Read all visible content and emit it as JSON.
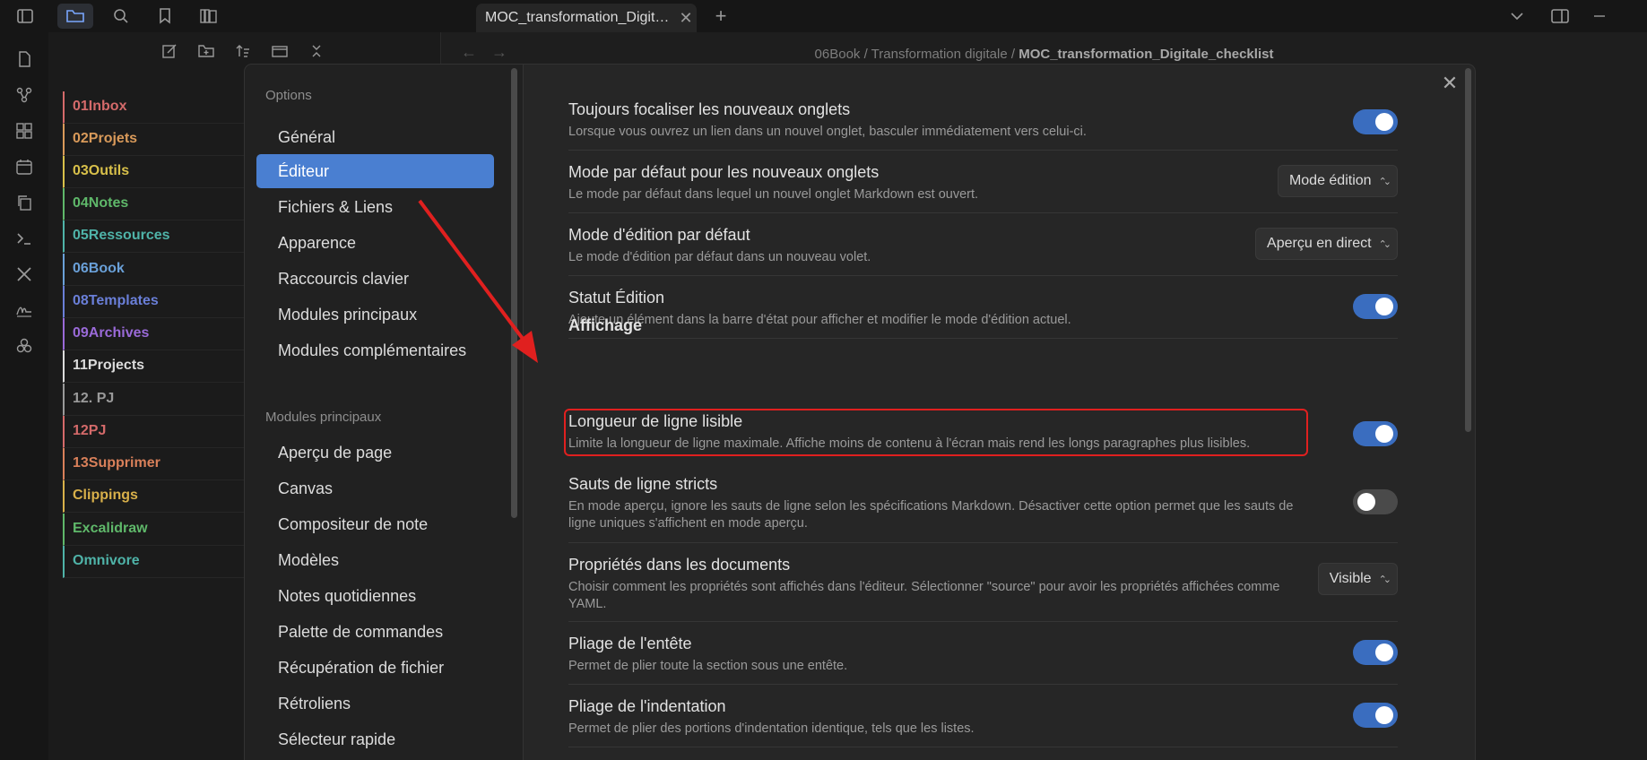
{
  "tab": {
    "title": "MOC_transformation_Digit…",
    "close": "✕",
    "new_tab": "+"
  },
  "breadcrumb": {
    "part1": "06Book",
    "sep": "/",
    "part2": "Transformation digitale",
    "current": "MOC_transformation_Digitale_checklist"
  },
  "folders": [
    {
      "label": "01Inbox",
      "color": "#d46a6a"
    },
    {
      "label": "02Projets",
      "color": "#d99a5a"
    },
    {
      "label": "03Outils",
      "color": "#d8c04a"
    },
    {
      "label": "04Notes",
      "color": "#5fb86a"
    },
    {
      "label": "05Ressources",
      "color": "#4fb3a8"
    },
    {
      "label": "06Book",
      "color": "#6aa0d8"
    },
    {
      "label": "08Templates",
      "color": "#6a7fd8"
    },
    {
      "label": "09Archives",
      "color": "#9a6ad8"
    },
    {
      "label": "11Projects",
      "color": "#dcdcdc"
    },
    {
      "label": "12. PJ",
      "color": "#9a9a9a"
    },
    {
      "label": "12PJ",
      "color": "#d46a6a"
    },
    {
      "label": "13Supprimer",
      "color": "#d9805a"
    },
    {
      "label": "Clippings",
      "color": "#d8b04a"
    },
    {
      "label": "Excalidraw",
      "color": "#5fb86a"
    },
    {
      "label": "Omnivore",
      "color": "#4fb3a8"
    }
  ],
  "settings_sidebar": {
    "heading_options": "Options",
    "options": [
      "Général",
      "Éditeur",
      "Fichiers & Liens",
      "Apparence",
      "Raccourcis clavier",
      "Modules principaux",
      "Modules complémentaires"
    ],
    "active_option": "Éditeur",
    "heading_core": "Modules principaux",
    "core": [
      "Aperçu de page",
      "Canvas",
      "Compositeur de note",
      "Modèles",
      "Notes quotidiennes",
      "Palette de commandes",
      "Récupération de fichier",
      "Rétroliens",
      "Sélecteur rapide"
    ]
  },
  "settings": [
    {
      "name": "Toujours focaliser les nouveaux onglets",
      "desc": "Lorsque vous ouvrez un lien dans un nouvel onglet, basculer immédiatement vers celui-ci.",
      "control": "toggle",
      "value": true
    },
    {
      "name": "Mode par défaut pour les nouveaux onglets",
      "desc": "Le mode par défaut dans lequel un nouvel onglet Markdown est ouvert.",
      "control": "dropdown",
      "value": "Mode édition"
    },
    {
      "name": "Mode d'édition par défaut",
      "desc": "Le mode d'édition par défaut dans un nouveau volet.",
      "control": "dropdown",
      "value": "Aperçu en direct"
    },
    {
      "name": "Statut Édition",
      "desc": "Ajoute un élément dans la barre d'état pour afficher et modifier le mode d'édition actuel.",
      "control": "toggle",
      "value": true
    }
  ],
  "section_affichage": "Affichage",
  "settings2": [
    {
      "name": "Longueur de ligne lisible",
      "desc": "Limite la longueur de ligne maximale. Affiche moins de contenu à l'écran mais rend les longs paragraphes plus lisibles.",
      "control": "toggle",
      "value": true
    },
    {
      "name": "Sauts de ligne stricts",
      "desc": "En mode aperçu, ignore les sauts de ligne selon les spécifications Markdown. Désactiver cette option permet que les sauts de ligne uniques s'affichent en mode aperçu.",
      "control": "toggle",
      "value": false
    },
    {
      "name": "Propriétés dans les documents",
      "desc": "Choisir comment les propriétés sont affichés dans l'éditeur. Sélectionner \"source\" pour avoir les propriétés affichées comme YAML.",
      "control": "dropdown",
      "value": "Visible"
    },
    {
      "name": "Pliage de l'entête",
      "desc": "Permet de plier toute la section sous une entête.",
      "control": "toggle",
      "value": true
    },
    {
      "name": "Pliage de l'indentation",
      "desc": "Permet de plier des portions d'indentation identique, tels que les listes.",
      "control": "toggle",
      "value": true
    }
  ],
  "colors": {
    "accent": "#4a7fd1",
    "highlight": "#e0201f",
    "toggle_on": "#3a6dbf"
  }
}
